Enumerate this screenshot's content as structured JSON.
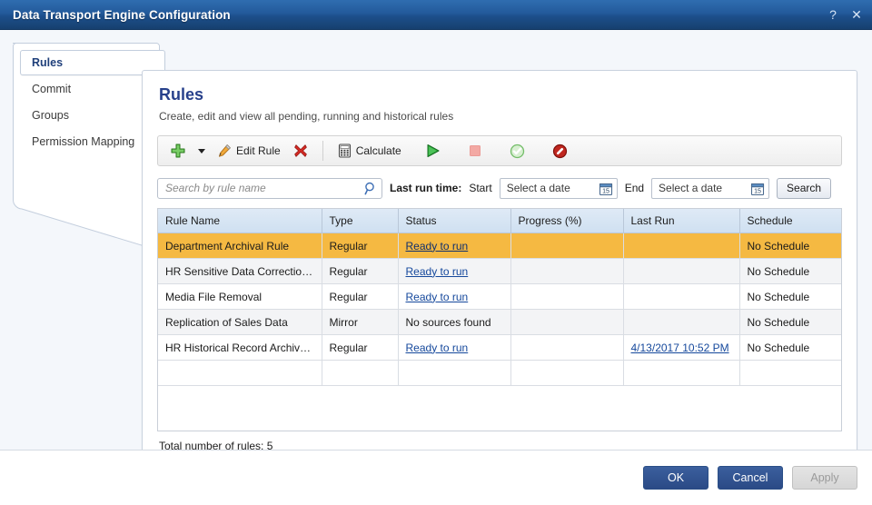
{
  "window": {
    "title": "Data Transport Engine Configuration",
    "help_label": "?",
    "close_label": "✕",
    "accent_color": "#1d4f8c"
  },
  "sidebar": {
    "items": [
      {
        "label": "Rules",
        "selected": true
      },
      {
        "label": "Commit",
        "selected": false
      },
      {
        "label": "Groups",
        "selected": false
      },
      {
        "label": "Permission Mapping",
        "selected": false
      }
    ]
  },
  "page": {
    "title": "Rules",
    "subtitle": "Create, edit and view all pending, running and historical rules"
  },
  "toolbar": {
    "add_icon": "plus-icon",
    "add_label": "",
    "dropdown_icon": "chevron-down-icon",
    "edit_icon": "pencil-icon",
    "edit_label": "Edit Rule",
    "delete_icon": "red-x-icon",
    "calculate_icon": "calculator-icon",
    "calculate_label": "Calculate",
    "run_icon": "play-icon",
    "stop_icon": "stop-square-icon",
    "approve_icon": "check-circle-icon",
    "deny_icon": "prohibited-circle-icon"
  },
  "filters": {
    "search_placeholder": "Search by rule name",
    "search_value": "",
    "search_icon": "magnifier-icon",
    "last_run_label": "Last run time:",
    "start_label": "Start",
    "start_value": "Select a date",
    "end_label": "End",
    "end_value": "Select a date",
    "calendar_icon": "calendar-icon",
    "calendar_day": "15",
    "search_button": "Search"
  },
  "grid": {
    "columns": [
      "Rule Name",
      "Type",
      "Status",
      "Progress (%)",
      "Last Run",
      "Schedule"
    ],
    "rows": [
      {
        "rule_name": "Department Archival Rule",
        "type": "Regular",
        "status": "Ready to run",
        "status_is_link": true,
        "progress": "",
        "last_run": "",
        "last_run_is_link": false,
        "schedule": "No Schedule",
        "selected": true
      },
      {
        "rule_name": "HR Sensitive Data Correction...",
        "type": "Regular",
        "status": "Ready to run",
        "status_is_link": true,
        "progress": "",
        "last_run": "",
        "last_run_is_link": false,
        "schedule": "No Schedule",
        "selected": false
      },
      {
        "rule_name": "Media File Removal",
        "type": "Regular",
        "status": "Ready to run",
        "status_is_link": true,
        "progress": "",
        "last_run": "",
        "last_run_is_link": false,
        "schedule": "No Schedule",
        "selected": false
      },
      {
        "rule_name": "Replication of Sales Data",
        "type": "Mirror",
        "status": "No sources found",
        "status_is_link": false,
        "progress": "",
        "last_run": "",
        "last_run_is_link": false,
        "schedule": "No Schedule",
        "selected": false
      },
      {
        "rule_name": "HR Historical Record Archive...",
        "type": "Regular",
        "status": "Ready to run",
        "status_is_link": true,
        "progress": "",
        "last_run": "4/13/2017 10:52 PM",
        "last_run_is_link": true,
        "schedule": "No Schedule",
        "selected": false
      }
    ],
    "total_text": "Total number of rules: 5",
    "selected_row_color": "#f5b942",
    "link_color": "#15489c"
  },
  "footer": {
    "ok_label": "OK",
    "cancel_label": "Cancel",
    "apply_label": "Apply",
    "apply_enabled": false
  }
}
